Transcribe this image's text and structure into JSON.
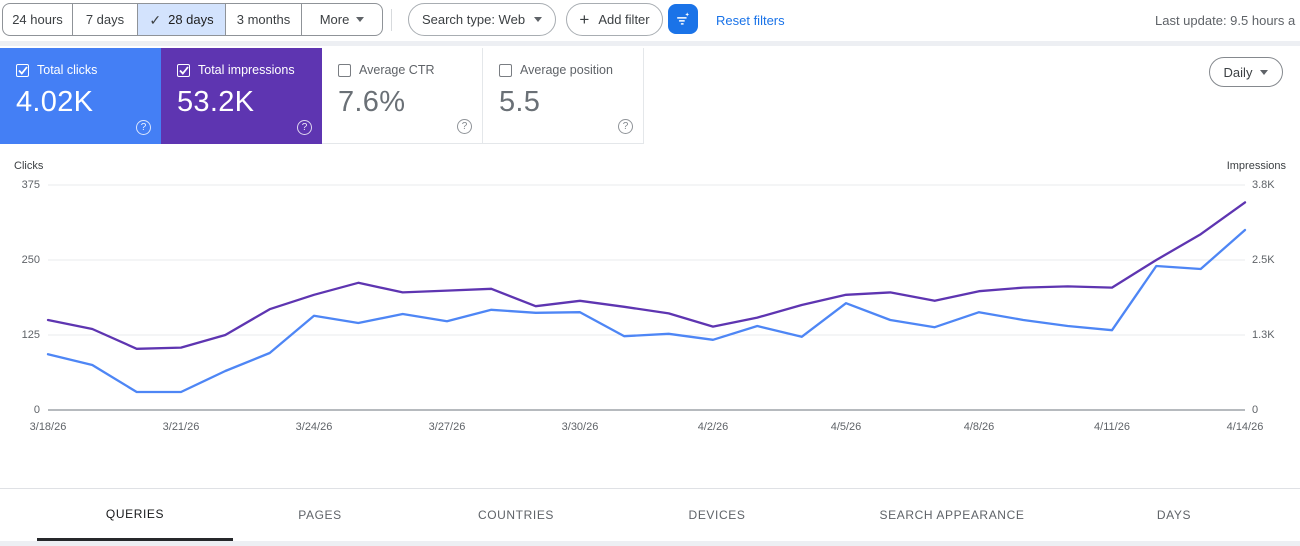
{
  "toolbar": {
    "date_ranges": [
      {
        "id": "24-hours",
        "label": "24 hours",
        "selected": false
      },
      {
        "id": "7-days",
        "label": "7 days",
        "selected": false
      },
      {
        "id": "28-days",
        "label": "28 days",
        "selected": true
      },
      {
        "id": "3-months",
        "label": "3 months",
        "selected": false
      },
      {
        "id": "more",
        "label": "More",
        "selected": false,
        "has_dropdown": true
      }
    ],
    "search_type_label": "Search type: Web",
    "add_filter_label": "Add filter",
    "reset_filters_label": "Reset filters",
    "last_update_text": "Last update: 9.5 hours a"
  },
  "metric_cards": [
    {
      "id": "total-clicks",
      "label": "Total clicks",
      "value": "4.02K",
      "checked": true,
      "color": "#447ff5"
    },
    {
      "id": "total-impressions",
      "label": "Total impressions",
      "value": "53.2K",
      "checked": true,
      "color": "#5e35b1"
    },
    {
      "id": "average-ctr",
      "label": "Average CTR",
      "value": "7.6%",
      "checked": false,
      "color": "#ffffff"
    },
    {
      "id": "average-position",
      "label": "Average position",
      "value": "5.5",
      "checked": false,
      "color": "#ffffff"
    }
  ],
  "granularity_label": "Daily",
  "chart_data": {
    "type": "line",
    "title": "Search performance over time",
    "x": [
      "3/18/26",
      "3/19/26",
      "3/20/26",
      "3/21/26",
      "3/22/26",
      "3/23/26",
      "3/24/26",
      "3/25/26",
      "3/26/26",
      "3/27/26",
      "3/28/26",
      "3/29/26",
      "3/30/26",
      "3/31/26",
      "4/1/26",
      "4/2/26",
      "4/3/26",
      "4/4/26",
      "4/5/26",
      "4/6/26",
      "4/7/26",
      "4/8/26",
      "4/9/26",
      "4/10/26",
      "4/11/26",
      "4/12/26",
      "4/13/26",
      "4/14/26"
    ],
    "x_tick_labels": [
      "3/18/26",
      "3/21/26",
      "3/24/26",
      "3/27/26",
      "3/30/26",
      "4/2/26",
      "4/5/26",
      "4/8/26",
      "4/11/26",
      "4/14/26"
    ],
    "series": [
      {
        "name": "Total clicks",
        "axis": "left",
        "color": "#4e86f5",
        "values": [
          93,
          75,
          30,
          30,
          65,
          95,
          157,
          145,
          160,
          148,
          167,
          162,
          163,
          123,
          127,
          117,
          140,
          122,
          178,
          150,
          138,
          163,
          150,
          140,
          133,
          240,
          235,
          300
        ]
      },
      {
        "name": "Total impressions",
        "axis": "right",
        "color": "#5e35b1",
        "values": [
          1500,
          1350,
          1020,
          1040,
          1250,
          1680,
          1920,
          2120,
          1960,
          1990,
          2020,
          1730,
          1820,
          1720,
          1610,
          1390,
          1540,
          1750,
          1920,
          1960,
          1820,
          1980,
          2040,
          2060,
          2040,
          2500,
          2930,
          3460
        ]
      }
    ],
    "left_axis": {
      "title": "Clicks",
      "ticks": [
        "0",
        "125",
        "250",
        "375"
      ],
      "range": [
        0,
        375
      ]
    },
    "right_axis": {
      "title": "Impressions",
      "ticks": [
        "0",
        "1.3K",
        "2.5K",
        "3.8K"
      ],
      "range": [
        0,
        3750
      ]
    },
    "grid": true,
    "legend_position": "none"
  },
  "tabs": [
    {
      "id": "queries",
      "label": "QUERIES",
      "active": true
    },
    {
      "id": "pages",
      "label": "PAGES",
      "active": false
    },
    {
      "id": "countries",
      "label": "COUNTRIES",
      "active": false
    },
    {
      "id": "devices",
      "label": "DEVICES",
      "active": false
    },
    {
      "id": "search-appearance",
      "label": "SEARCH APPEARANCE",
      "active": false
    },
    {
      "id": "days",
      "label": "DAYS",
      "active": false
    }
  ],
  "colors": {
    "accent": "#1a73e8",
    "selected_range_bg": "#d3e3fd",
    "grid_line": "#e9ebee",
    "axis_line": "#8a9096"
  }
}
